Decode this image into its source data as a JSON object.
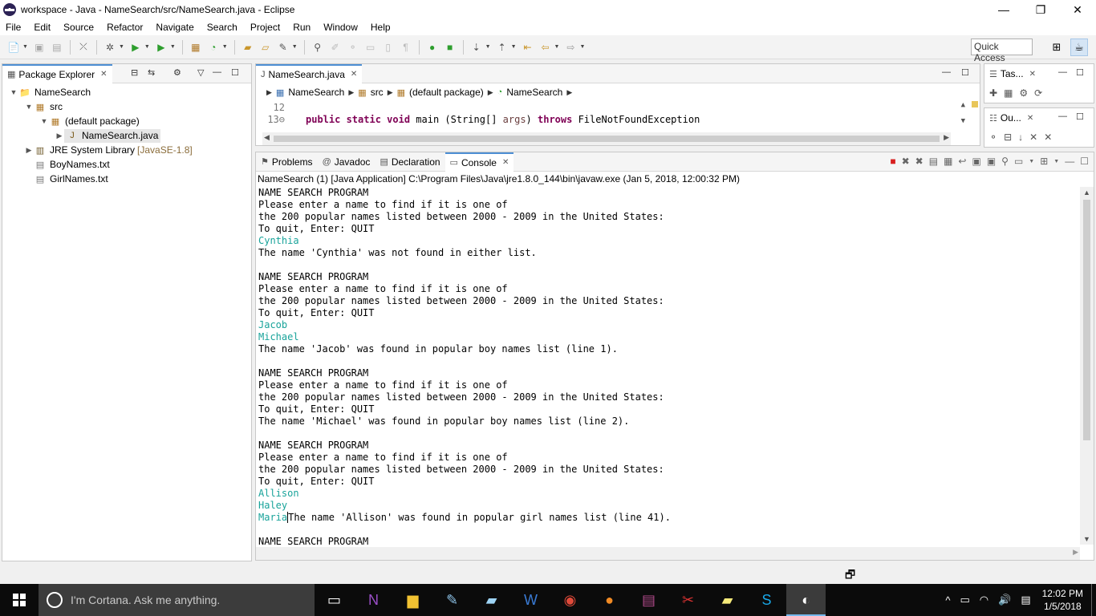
{
  "window": {
    "title": "workspace - Java - NameSearch/src/NameSearch.java - Eclipse",
    "controls": [
      "—",
      "❐",
      "✕"
    ]
  },
  "menu": [
    "File",
    "Edit",
    "Source",
    "Refactor",
    "Navigate",
    "Search",
    "Project",
    "Run",
    "Window",
    "Help"
  ],
  "toolbar": {
    "quick_access": "Quick Access"
  },
  "package_explorer": {
    "tab_label": "Package Explorer",
    "project": "NameSearch",
    "src": "src",
    "default_package": "(default package)",
    "java_file": "NameSearch.java",
    "jre_label": "JRE System Library",
    "jre_version": "[JavaSE-1.8]",
    "file1": "BoyNames.txt",
    "file2": "GirlNames.txt"
  },
  "editor": {
    "tab_label": "NameSearch.java",
    "breadcrumb": [
      "NameSearch",
      "src",
      "(default package)",
      "NameSearch"
    ],
    "lines": [
      {
        "no": "12",
        "text": ""
      },
      {
        "no": "13⊖",
        "kw1": "public static void",
        "mid": " main (String[] ",
        "param": "args",
        "mid2": ") ",
        "kw2": "throws",
        "tail": " FileNotFoundException"
      }
    ]
  },
  "side_panels": {
    "tasks_label": "Tas...",
    "outline_label": "Ou..."
  },
  "console": {
    "tabs": {
      "problems": "Problems",
      "javadoc": "Javadoc",
      "declaration": "Declaration",
      "console": "Console"
    },
    "launch_label": "NameSearch (1) [Java Application] C:\\Program Files\\Java\\jre1.8.0_144\\bin\\javaw.exe (Jan 5, 2018, 12:00:32 PM)",
    "lines": [
      {
        "t": "NAME SEARCH PROGRAM",
        "in": false
      },
      {
        "t": "Please enter a name to find if it is one of",
        "in": false
      },
      {
        "t": "the 200 popular names listed between 2000 - 2009 in the United States:",
        "in": false
      },
      {
        "t": "To quit, Enter: QUIT",
        "in": false
      },
      {
        "t": "Cynthia",
        "in": true
      },
      {
        "t": "The name 'Cynthia' was not found in either list.",
        "in": false
      },
      {
        "t": "",
        "in": false
      },
      {
        "t": "NAME SEARCH PROGRAM",
        "in": false
      },
      {
        "t": "Please enter a name to find if it is one of",
        "in": false
      },
      {
        "t": "the 200 popular names listed between 2000 - 2009 in the United States:",
        "in": false
      },
      {
        "t": "To quit, Enter: QUIT",
        "in": false
      },
      {
        "t": "Jacob",
        "in": true
      },
      {
        "t": "Michael",
        "in": true
      },
      {
        "t": "The name 'Jacob' was found in popular boy names list (line 1).",
        "in": false
      },
      {
        "t": "",
        "in": false
      },
      {
        "t": "NAME SEARCH PROGRAM",
        "in": false
      },
      {
        "t": "Please enter a name to find if it is one of",
        "in": false
      },
      {
        "t": "the 200 popular names listed between 2000 - 2009 in the United States:",
        "in": false
      },
      {
        "t": "To quit, Enter: QUIT",
        "in": false
      },
      {
        "t": "The name 'Michael' was found in popular boy names list (line 2).",
        "in": false
      },
      {
        "t": "",
        "in": false
      },
      {
        "t": "NAME SEARCH PROGRAM",
        "in": false
      },
      {
        "t": "Please enter a name to find if it is one of",
        "in": false
      },
      {
        "t": "the 200 popular names listed between 2000 - 2009 in the United States:",
        "in": false
      },
      {
        "t": "To quit, Enter: QUIT",
        "in": false
      },
      {
        "t": "Allison",
        "in": true
      },
      {
        "t": "Haley",
        "in": true
      },
      {
        "t": "Maria",
        "in": true,
        "tail": "The name 'Allison' was found in popular girl names list (line 41)."
      },
      {
        "t": "",
        "in": false
      },
      {
        "t": "NAME SEARCH PROGRAM",
        "in": false
      }
    ]
  },
  "taskbar": {
    "cortana": "I'm Cortana. Ask me anything.",
    "time": "12:02 PM",
    "date": "1/5/2018"
  },
  "colors": {
    "accent": "#4d8fd4",
    "console_input": "#18a39a",
    "keyword": "#7f0055"
  }
}
